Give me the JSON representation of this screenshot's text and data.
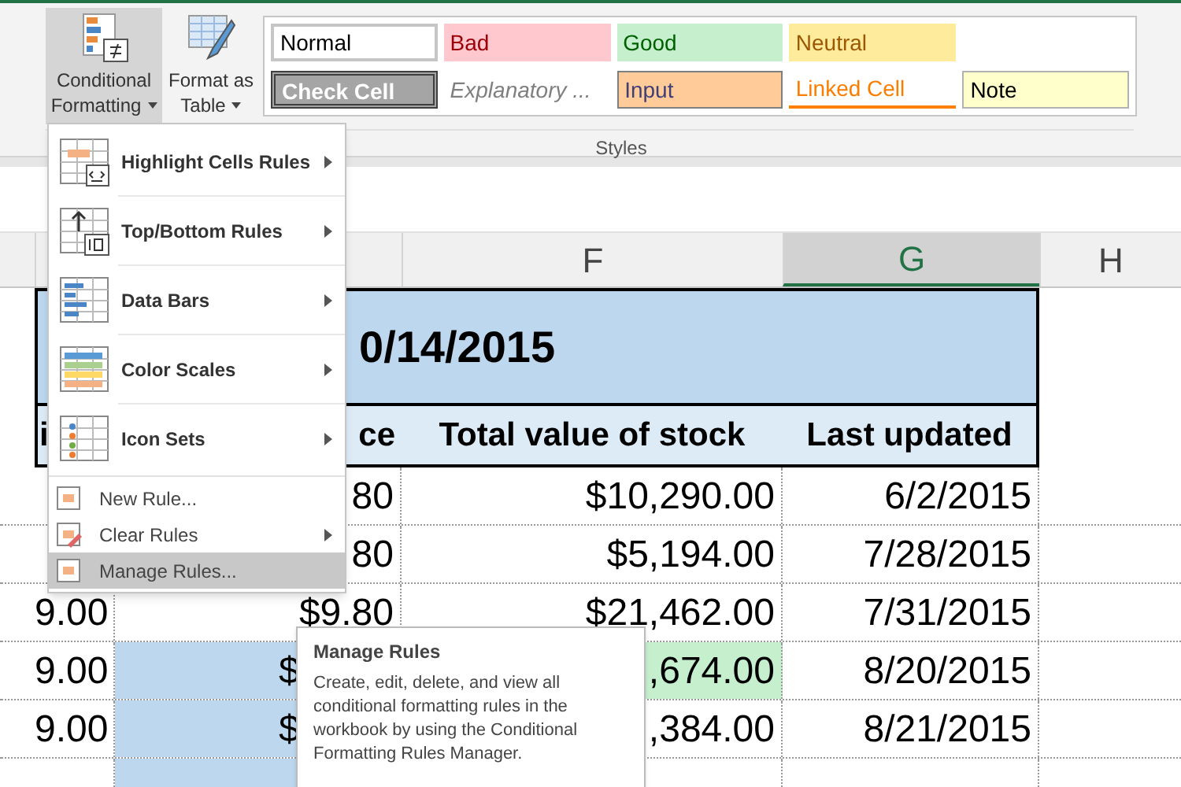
{
  "ribbon": {
    "buttons": [
      {
        "lines": [
          "Conditional",
          "Formatting"
        ],
        "selected": true
      },
      {
        "lines": [
          "Format as",
          "Table"
        ],
        "selected": false
      }
    ],
    "cell_styles": [
      [
        {
          "label": "Normal",
          "kind": "normal"
        },
        {
          "label": "Bad",
          "kind": "bad"
        },
        {
          "label": "Good",
          "kind": "good"
        },
        {
          "label": "Neutral",
          "kind": "neutral"
        }
      ],
      [
        {
          "label": "Check Cell",
          "kind": "check"
        },
        {
          "label": "Explanatory ...",
          "kind": "explanatory"
        },
        {
          "label": "Input",
          "kind": "input"
        },
        {
          "label": "Linked Cell",
          "kind": "linked"
        },
        {
          "label": "Note",
          "kind": "note"
        }
      ]
    ],
    "group_label": "Styles"
  },
  "menu": {
    "items": [
      {
        "label": "Highlight Cells Rules",
        "kind": "large",
        "submenu": true,
        "selected": false
      },
      {
        "label": "Top/Bottom Rules",
        "kind": "large",
        "submenu": true,
        "selected": false
      },
      {
        "label": "Data Bars",
        "kind": "large",
        "submenu": true,
        "selected": false
      },
      {
        "label": "Color Scales",
        "kind": "large",
        "submenu": true,
        "selected": false
      },
      {
        "label": "Icon Sets",
        "kind": "large",
        "submenu": true,
        "selected": false
      },
      {
        "label": "New Rule...",
        "kind": "small",
        "submenu": false,
        "selected": false
      },
      {
        "label": "Clear Rules",
        "kind": "small",
        "submenu": true,
        "selected": false
      },
      {
        "label": "Manage Rules...",
        "kind": "small",
        "submenu": false,
        "selected": true
      }
    ]
  },
  "sheet": {
    "columns": [
      {},
      {},
      {
        "label": "F",
        "selected": false
      },
      {
        "label": "G",
        "selected": true
      },
      {
        "label": "H",
        "selected": false
      }
    ],
    "title": "0/14/2015",
    "header": [
      "i",
      "ce",
      "Total value of stock",
      "Last updated"
    ],
    "rows": [
      {
        "cells": [
          {},
          {
            "text": "80"
          },
          {
            "text": "$10,290.00"
          },
          {
            "text": "6/2/2015"
          }
        ]
      },
      {
        "cells": [
          {},
          {
            "text": "80"
          },
          {
            "text": "$5,194.00"
          },
          {
            "text": "7/28/2015"
          }
        ]
      },
      {
        "cells": [
          {
            "text": "9.00"
          },
          {
            "text": "$9.80"
          },
          {
            "text": "$21,462.00"
          },
          {
            "text": "7/31/2015"
          }
        ]
      },
      {
        "cells": [
          {
            "text": "9.00"
          },
          {
            "text": "$",
            "color": "#bdd7ee",
            "left_part": true
          },
          {
            "text": ",674.00",
            "color": "#c6efce"
          },
          {
            "text": "8/20/2015"
          }
        ]
      },
      {
        "cells": [
          {
            "text": "9.00"
          },
          {
            "text": "$",
            "color": "#bdd7ee",
            "left_part": true
          },
          {
            "text": ",384.00"
          },
          {
            "text": "8/21/2015"
          }
        ]
      },
      {
        "cells": [
          {},
          {
            "color": "#bdd7ee"
          },
          {},
          {}
        ]
      }
    ]
  },
  "tooltip": {
    "title": "Manage Rules",
    "body": "Create, edit, delete, and view all conditional formatting rules in the workbook by using the Conditional Formatting Rules Manager."
  }
}
